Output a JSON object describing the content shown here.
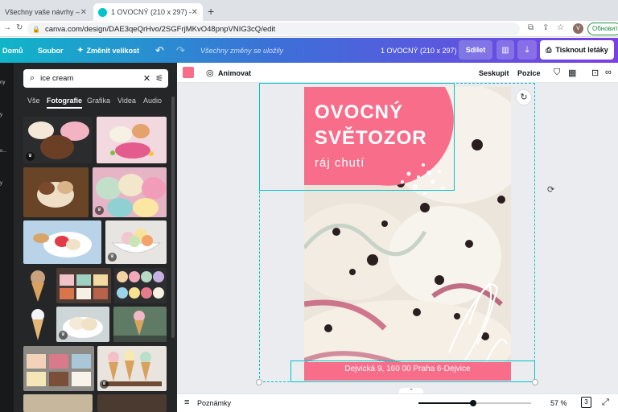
{
  "browser": {
    "tabs": [
      {
        "title": "Všechny vaše návrhy – Canva"
      },
      {
        "title": "1 OVOCNÝ (210 x 297) – Flyer"
      }
    ],
    "url": "canva.com/design/DAE3qeQrHvo/2SGFrjMKvO48pnpVNIG3cQ/edit",
    "profile_initial": "V",
    "update_label": "Обновить"
  },
  "header": {
    "home": "Domů",
    "file": "Soubor",
    "resize": "Změnit velikost",
    "saved_status": "Všechny změny se uložily",
    "doc_title": "1 OVOCNÝ (210 x 297)",
    "share": "Sdílet",
    "print": "Tisknout letáky"
  },
  "rail": [
    "ny",
    "y",
    "o...",
    "y"
  ],
  "panel": {
    "search_value": "ice cream",
    "tabs": [
      "Vše",
      "Fotografie",
      "Grafika",
      "Videa",
      "Audio"
    ],
    "active_tab": "Fotografie"
  },
  "context_bar": {
    "color": "#f76d8a",
    "animate": "Animovat",
    "group": "Seskupit",
    "position": "Pozice"
  },
  "flyer": {
    "title_line1": "OVOCNÝ",
    "title_line2": "SVĚTOZOR",
    "subtitle": "ráj chutí",
    "address": "Dejvická 9, 160 00 Praha 6-Dejvice",
    "accent": "#f76d8a"
  },
  "footer": {
    "notes": "Poznámky",
    "zoom": "57 %",
    "zoom_level": 0.57,
    "page_number": "3"
  }
}
